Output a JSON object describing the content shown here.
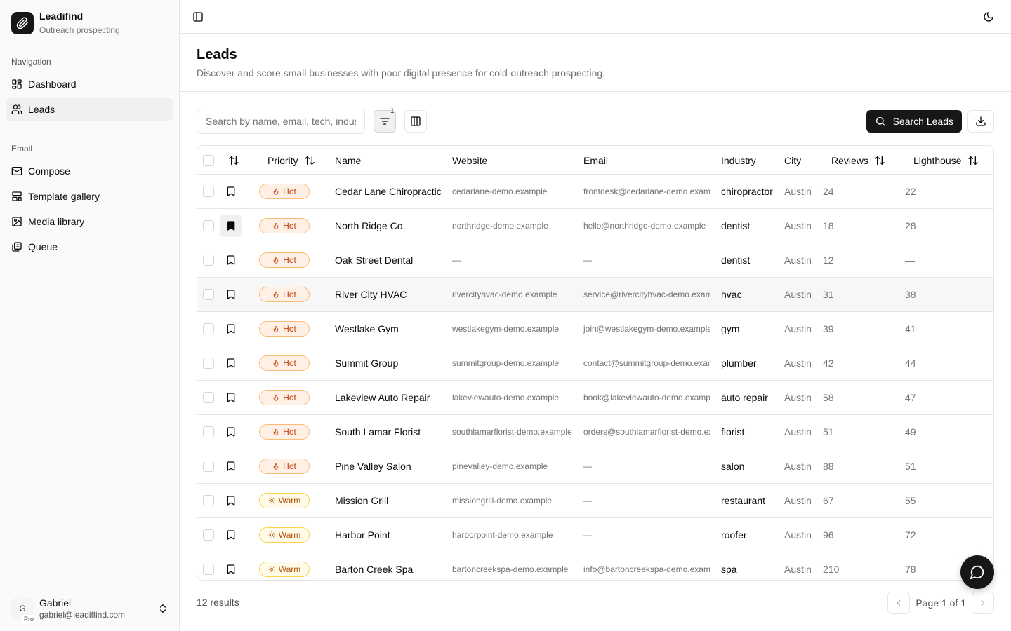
{
  "brand": {
    "name": "Leadifind",
    "subtitle": "Outreach prospecting"
  },
  "nav": {
    "group_label": "Navigation",
    "items": [
      {
        "label": "Dashboard",
        "icon": "dashboard-icon"
      },
      {
        "label": "Leads",
        "icon": "users-icon",
        "active": true
      }
    ]
  },
  "email_nav": {
    "group_label": "Email",
    "items": [
      {
        "label": "Compose",
        "icon": "compose-icon"
      },
      {
        "label": "Template gallery",
        "icon": "template-icon"
      },
      {
        "label": "Media library",
        "icon": "image-icon"
      },
      {
        "label": "Queue",
        "icon": "queue-icon"
      }
    ]
  },
  "user": {
    "initial": "G",
    "badge": "Pro",
    "name": "Gabriel",
    "email": "gabriel@leadiffind.com"
  },
  "page": {
    "title": "Leads",
    "description": "Discover and score small businesses with poor digital presence for cold-outreach prospecting."
  },
  "toolbar": {
    "search_placeholder": "Search by name, email, tech, industry...",
    "filter_count": "1",
    "search_button": "Search Leads"
  },
  "table": {
    "headers": {
      "priority": "Priority",
      "name": "Name",
      "website": "Website",
      "email": "Email",
      "industry": "Industry",
      "city": "City",
      "reviews": "Reviews",
      "lighthouse": "Lighthouse"
    },
    "rows": [
      {
        "priority": "Hot",
        "name": "Cedar Lane Chiropractic",
        "website": "cedarlane-demo.example",
        "email": "frontdesk@cedarlane-demo.example",
        "industry": "chiropractor",
        "city": "Austin",
        "reviews": "24",
        "lighthouse": "22"
      },
      {
        "priority": "Hot",
        "name": "North Ridge Co.",
        "website": "northridge-demo.example",
        "email": "hello@northridge-demo.example",
        "industry": "dentist",
        "city": "Austin",
        "reviews": "18",
        "lighthouse": "28",
        "bookmarked": true
      },
      {
        "priority": "Hot",
        "name": "Oak Street Dental",
        "website": "—",
        "email": "—",
        "industry": "dentist",
        "city": "Austin",
        "reviews": "12",
        "lighthouse": "—"
      },
      {
        "priority": "Hot",
        "name": "River City HVAC",
        "website": "rivercityhvac-demo.example",
        "email": "service@rivercityhvac-demo.example",
        "industry": "hvac",
        "city": "Austin",
        "reviews": "31",
        "lighthouse": "38",
        "hover": true
      },
      {
        "priority": "Hot",
        "name": "Westlake Gym",
        "website": "westlakegym-demo.example",
        "email": "join@westlakegym-demo.example",
        "industry": "gym",
        "city": "Austin",
        "reviews": "39",
        "lighthouse": "41"
      },
      {
        "priority": "Hot",
        "name": "Summit Group",
        "website": "summitgroup-demo.example",
        "email": "contact@summitgroup-demo.example",
        "industry": "plumber",
        "city": "Austin",
        "reviews": "42",
        "lighthouse": "44"
      },
      {
        "priority": "Hot",
        "name": "Lakeview Auto Repair",
        "website": "lakeviewauto-demo.example",
        "email": "book@lakeviewauto-demo.example",
        "industry": "auto repair",
        "city": "Austin",
        "reviews": "58",
        "lighthouse": "47"
      },
      {
        "priority": "Hot",
        "name": "South Lamar Florist",
        "website": "southlamarflorist-demo.example",
        "email": "orders@southlamarflorist-demo.example",
        "industry": "florist",
        "city": "Austin",
        "reviews": "51",
        "lighthouse": "49"
      },
      {
        "priority": "Hot",
        "name": "Pine Valley Salon",
        "website": "pinevalley-demo.example",
        "email": "—",
        "industry": "salon",
        "city": "Austin",
        "reviews": "88",
        "lighthouse": "51"
      },
      {
        "priority": "Warm",
        "name": "Mission Grill",
        "website": "missiongrill-demo.example",
        "email": "—",
        "industry": "restaurant",
        "city": "Austin",
        "reviews": "67",
        "lighthouse": "55"
      },
      {
        "priority": "Warm",
        "name": "Harbor Point",
        "website": "harborpoint-demo.example",
        "email": "—",
        "industry": "roofer",
        "city": "Austin",
        "reviews": "96",
        "lighthouse": "72"
      },
      {
        "priority": "Warm",
        "name": "Barton Creek Spa",
        "website": "bartoncreekspa-demo.example",
        "email": "info@bartoncreekspa-demo.example",
        "industry": "spa",
        "city": "Austin",
        "reviews": "210",
        "lighthouse": "78"
      }
    ]
  },
  "footer": {
    "results": "12 results",
    "page": "Page 1 of 1"
  },
  "colors": {
    "hot": "#c2410c",
    "warm": "#b45309",
    "primary": "#171717"
  }
}
